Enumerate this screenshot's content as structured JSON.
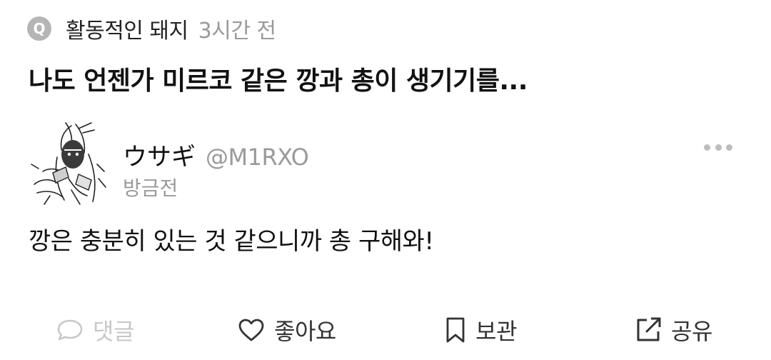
{
  "question": {
    "badge": "Q",
    "author": "활동적인 돼지",
    "time": "3시간 전",
    "title": "나도 언젠가 미르코 같은 깡과 총이 생기기를..."
  },
  "reply": {
    "name": "ウサギ",
    "handle": "@M1RXO",
    "time": "방금전",
    "body": "깡은 충분히 있는 것 같으니까 총 구해와!"
  },
  "actions": {
    "comment": "댓글",
    "like": "좋아요",
    "save": "보관",
    "share": "공유"
  },
  "icons": {
    "comment": "speech-bubble-icon",
    "like": "heart-icon",
    "save": "bookmark-icon",
    "share": "external-share-icon",
    "more": "more-dots-icon"
  },
  "colors": {
    "badge": "#b5b5b5",
    "muted": "#9a9a9a",
    "disabled": "#c8c8c8",
    "text": "#111111"
  }
}
